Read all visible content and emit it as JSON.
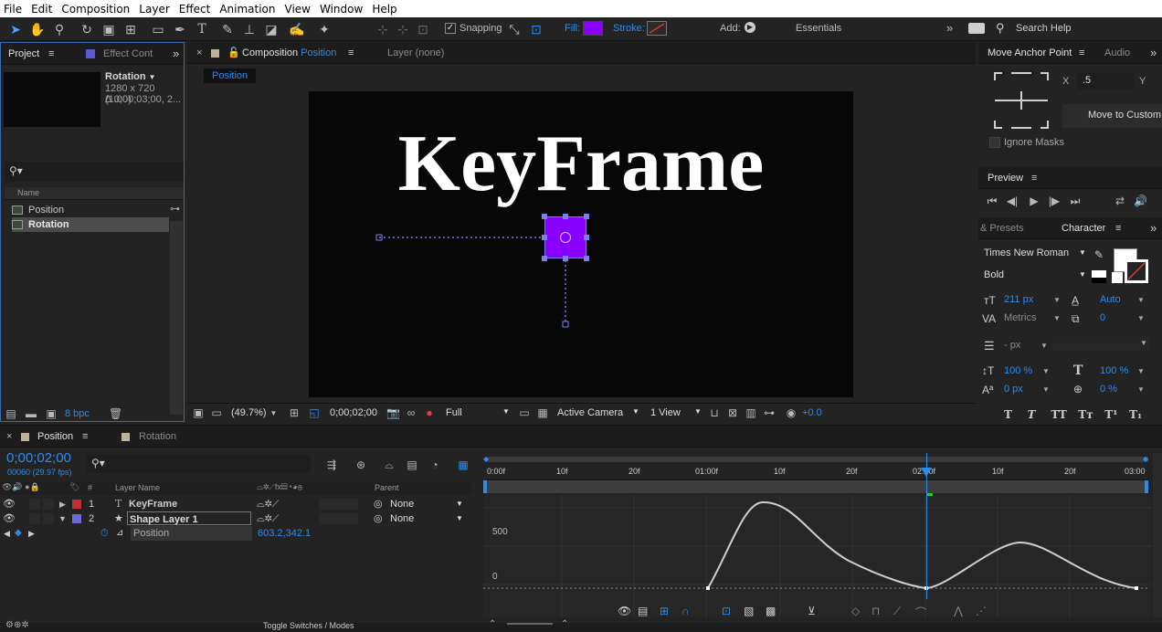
{
  "menu": [
    "File",
    "Edit",
    "Composition",
    "Layer",
    "Effect",
    "Animation",
    "View",
    "Window",
    "Help"
  ],
  "toolbar": {
    "snapping_label": "Snapping",
    "fill_label": "Fill:",
    "stroke_label": "Stroke:",
    "add_label": "Add:",
    "workspace": "Essentials",
    "search_placeholder": "Search Help",
    "fill_color": "#8a00ff"
  },
  "project": {
    "tab_project": "Project",
    "tab_effect": "Effect Cont",
    "comp_name": "Rotation",
    "comp_size": "1280 x 720 (1.00)",
    "comp_duration": "Δ 0;00;03;00, 2...",
    "col_name": "Name",
    "items": [
      {
        "label": "Position"
      },
      {
        "label": "Rotation"
      }
    ],
    "bpc": "8 bpc"
  },
  "composition": {
    "tab_prefix": "Composition",
    "tab_name": "Position",
    "layer_tab": "Layer (none)",
    "breadcrumb": "Position",
    "text_layer": "KeyFrame",
    "shape_color": "#8a00ff",
    "zoom": "(49.7%)",
    "timecode": "0;00;02;00",
    "resolution": "Full",
    "camera": "Active Camera",
    "views": "1 View",
    "exposure": "+0.0"
  },
  "anchor": {
    "tab": "Move Anchor Point",
    "tab_audio": "Audio",
    "x_label": "X",
    "x_value": ".5",
    "y_label": "Y",
    "move_custom": "Move to Custom",
    "ignore_masks": "Ignore Masks"
  },
  "preview": {
    "tab": "Preview"
  },
  "character": {
    "tab_presets": "& Presets",
    "tab": "Character",
    "font": "Times New Roman",
    "style": "Bold",
    "size": "211 px",
    "leading": "Auto",
    "kerning": "Metrics",
    "tracking": "0",
    "stroke_width": "- px",
    "vscale": "100 %",
    "hscale": "100 %",
    "baseline": "0 px",
    "tsume": "0 %"
  },
  "timeline": {
    "tab_position": "Position",
    "tab_rotation": "Rotation",
    "timecode": "0;00;02;00",
    "fps": "00060 (29.97 fps)",
    "col_layer_name": "Layer Name",
    "col_parent": "Parent",
    "col_hash": "#",
    "layers": [
      {
        "num": "1",
        "name": "KeyFrame",
        "parent": "None",
        "color": "#c03030"
      },
      {
        "num": "2",
        "name": "Shape Layer 1",
        "parent": "None",
        "color": "#6a6ad8"
      }
    ],
    "property": "Position",
    "property_value": "603.2,342.1",
    "toggle_label": "Toggle Switches / Modes",
    "ruler": [
      "0:00f",
      "10f",
      "20f",
      "01:00f",
      "10f",
      "20f",
      "02:00f",
      "10f",
      "20f",
      "03:00"
    ],
    "graph_labels": [
      "500",
      "0"
    ]
  }
}
